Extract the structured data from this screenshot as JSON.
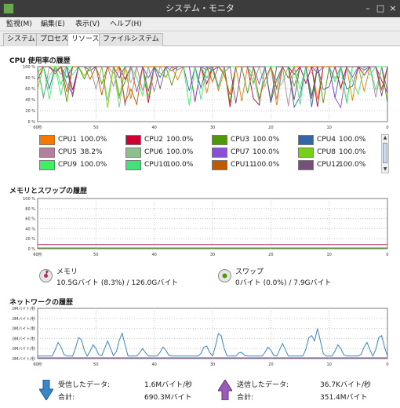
{
  "window": {
    "title": "システム・モニタ",
    "controls": [
      "–",
      "□",
      "×"
    ]
  },
  "menu": [
    "監視(M)",
    "編集(E)",
    "表示(V)",
    "ヘルプ(H)"
  ],
  "tabs": [
    "システム",
    "プロセス",
    "リソース",
    "ファイルシステム"
  ],
  "active_tab": "リソース",
  "cpu": {
    "title": "CPU 使用率の履歴",
    "y_ticks": [
      "100 %",
      "80 %",
      "60 %",
      "40 %",
      "20 %",
      "0 %"
    ],
    "x_ticks": [
      "60秒",
      "50",
      "40",
      "30",
      "20",
      "10",
      "0"
    ],
    "legend": [
      {
        "name": "CPU1",
        "value": "100.0%",
        "color": "#f57900"
      },
      {
        "name": "CPU2",
        "value": "100.0%",
        "color": "#cc0033"
      },
      {
        "name": "CPU3",
        "value": "100.0%",
        "color": "#4e9a06"
      },
      {
        "name": "CPU4",
        "value": "100.0%",
        "color": "#3465a4"
      },
      {
        "name": "CPU5",
        "value": "38.2%",
        "color": "#b480a0"
      },
      {
        "name": "CPU6",
        "value": "100.0%",
        "color": "#8fbf8f"
      },
      {
        "name": "CPU7",
        "value": "100.0%",
        "color": "#8a4fd6"
      },
      {
        "name": "CPU8",
        "value": "100.0%",
        "color": "#73d216"
      },
      {
        "name": "CPU9",
        "value": "100.0%",
        "color": "#3cf060"
      },
      {
        "name": "CPU10",
        "value": "100.0%",
        "color": "#44e07a"
      },
      {
        "name": "CPU11",
        "value": "100.0%",
        "color": "#c05a00"
      },
      {
        "name": "CPU12",
        "value": "100.0%",
        "color": "#75507b"
      }
    ]
  },
  "memory": {
    "title": "メモリとスワップの履歴",
    "y_ticks": [
      "100 %",
      "80 %",
      "60 %",
      "40 %",
      "20 %",
      "0 %"
    ],
    "x_ticks": [
      "60秒",
      "50",
      "40",
      "30",
      "20",
      "10",
      "0"
    ],
    "mem_label": "メモリ",
    "mem_value": "10.5Gバイト (8.3%) / 126.0Gバイト",
    "mem_percent": 8.3,
    "mem_color": "#b0306a",
    "swap_label": "スワップ",
    "swap_value": "0バイト (0.0%) / 7.9Gバイト",
    "swap_percent": 0.0,
    "swap_color": "#4e9a06"
  },
  "network": {
    "title": "ネットワークの履歴",
    "y_ticks": [
      ".0Mバイト/秒",
      ".0Mバイト/秒",
      ".0Mバイト/秒",
      ".0Mバイト/秒",
      ".0Mバイト/秒",
      ".0Mバイト/秒"
    ],
    "x_ticks": [
      "60秒",
      "50",
      "40",
      "30",
      "20",
      "10",
      "0"
    ],
    "recv_label": "受信したデータ:",
    "recv_rate": "1.6Mバイト/秒",
    "recv_total_label": "合計:",
    "recv_total": "690.3Mバイト",
    "recv_color": "#3a86c8",
    "send_label": "送信したデータ:",
    "send_rate": "36.7Kバイト/秒",
    "send_total_label": "合計:",
    "send_total": "351.4Mバイト",
    "send_color": "#8a4fa6"
  }
}
